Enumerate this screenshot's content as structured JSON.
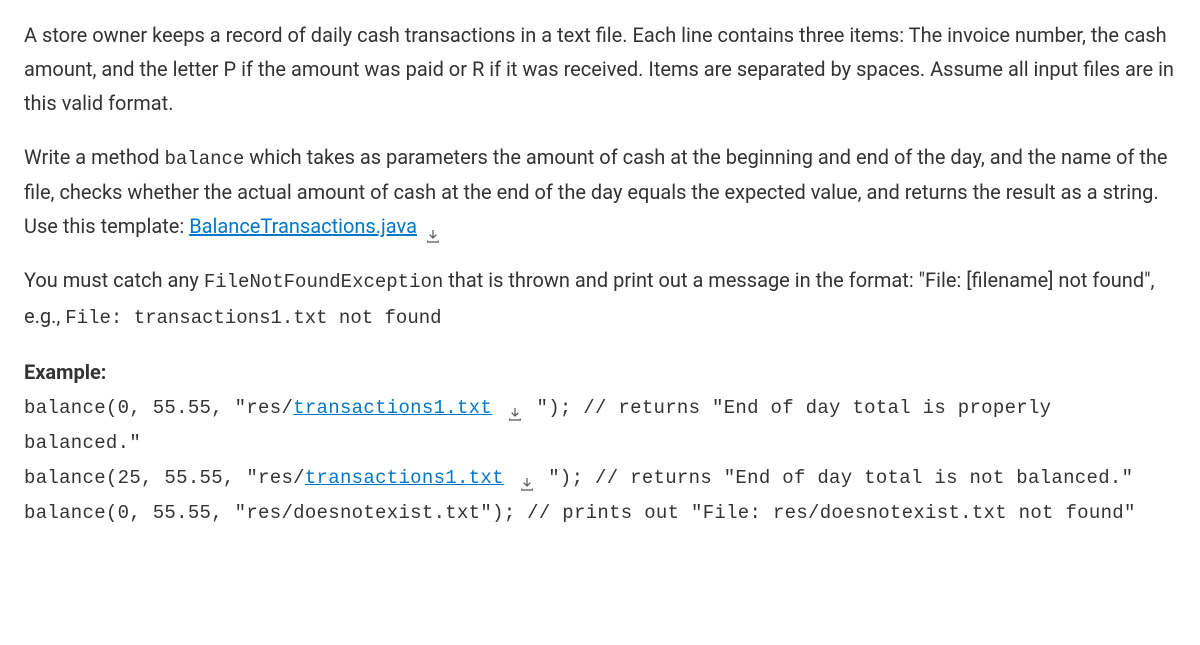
{
  "para1": "A store owner keeps a record of daily cash transactions in a text file. Each line contains three items: The invoice number, the cash amount, and the letter P if the amount was paid or R if it was received. Items are separated by spaces. Assume all input files are in this valid format.",
  "para2": {
    "pre": "Write a method ",
    "code1": "balance",
    "mid": " which takes as parameters the amount of cash at the beginning and end of the day, and the name of the file, checks whether the actual amount of cash at the end of the day equals the expected value, and returns the result as a string. Use this template: ",
    "link": "BalanceTransactions.java"
  },
  "para3": {
    "pre": "You must catch any ",
    "code1": "FileNotFoundException",
    "mid": " that is thrown and print out a message in the format: \"File: [filename] not found\", e.g., ",
    "code2": "File: transactions1.txt not found"
  },
  "exampleLabel": "Example:",
  "ex1": {
    "a": "balance(0, 55.55, \"res/",
    "link": "transactions1.txt",
    "b": " \"); // returns \"End of day total is properly balanced.\""
  },
  "ex2": {
    "a": "balance(25, 55.55, \"res/",
    "link": "transactions1.txt",
    "b": " \"); // returns \"End of day total is not balanced.\""
  },
  "ex3": "balance(0, 55.55, \"res/doesnotexist.txt\"); // prints out \"File: res/doesnotexist.txt not found\""
}
